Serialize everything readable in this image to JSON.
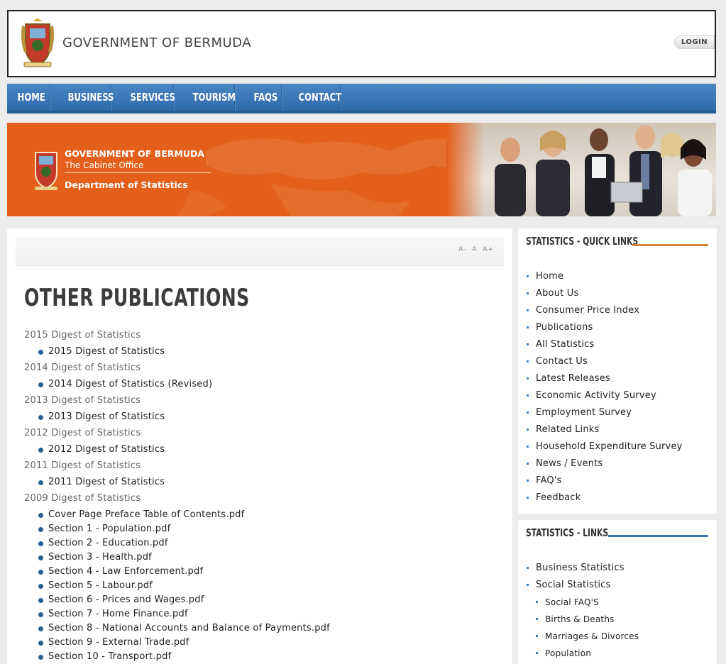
{
  "header": {
    "site_title": "GOVERNMENT OF BERMUDA",
    "login_label": "LOGIN"
  },
  "nav": {
    "items": [
      {
        "label": "HOME"
      },
      {
        "label": "BUSINESS"
      },
      {
        "label": "SERVICES"
      },
      {
        "label": "TOURISM"
      },
      {
        "label": "FAQS"
      },
      {
        "label": "CONTACT"
      }
    ]
  },
  "banner": {
    "gov": "GOVERNMENT OF BERMUDA",
    "office": "The Cabinet Office",
    "dept": "Department of Statistics"
  },
  "toolbar": {
    "decrease": "A-",
    "normal": "A",
    "increase": "A+"
  },
  "main": {
    "title": "OTHER PUBLICATIONS",
    "groups": [
      {
        "title": "2015 Digest of Statistics",
        "links": [
          "2015 Digest of Statistics"
        ]
      },
      {
        "title": "2014 Digest of Statistics",
        "links": [
          "2014 Digest of Statistics (Revised)"
        ]
      },
      {
        "title": "2013 Digest of Statistics",
        "links": [
          "2013 Digest of Statistics"
        ]
      },
      {
        "title": "2012 Digest of Statistics",
        "links": [
          "2012 Digest of Statistics"
        ]
      },
      {
        "title": "2011 Digest of Statistics",
        "links": [
          "2011 Digest of Statistics"
        ]
      },
      {
        "title": "2009 Digest of Statistics",
        "links": [
          "Cover Page Preface Table of Contents.pdf",
          "Section 1 - Population.pdf",
          "Section 2 - Education.pdf",
          "Section 3 - Health.pdf",
          "Section 4 - Law Enforcement.pdf",
          "Section 5 - Labour.pdf",
          "Section 6 - Prices and Wages.pdf",
          "Section 7 - Home Finance.pdf",
          "Section 8 - National Accounts and Balance of Payments.pdf",
          "Section 9 - External Trade.pdf",
          "Section 10 - Transport.pdf"
        ]
      }
    ]
  },
  "quick_links": {
    "title": "STATISTICS - QUICK LINKS",
    "rule_color": "#d08a3a",
    "items": [
      "Home",
      "About Us",
      "Consumer Price Index",
      "Publications",
      "All Statistics",
      "Contact Us",
      "Latest Releases",
      "Economic Activity Survey",
      "Employment Survey",
      "Related Links",
      "Household Expenditure Survey",
      "News / Events",
      "FAQ's",
      "Feedback"
    ]
  },
  "stat_links": {
    "title": "STATISTICS - LINKS",
    "rule_color": "#3a78b8",
    "items": [
      {
        "label": "Business Statistics",
        "sub": false
      },
      {
        "label": "Social Statistics",
        "sub": false
      },
      {
        "label": "Social FAQ'S",
        "sub": true
      },
      {
        "label": "Births & Deaths",
        "sub": true
      },
      {
        "label": "Marriages & Divorces",
        "sub": true
      },
      {
        "label": "Population",
        "sub": true
      }
    ]
  }
}
